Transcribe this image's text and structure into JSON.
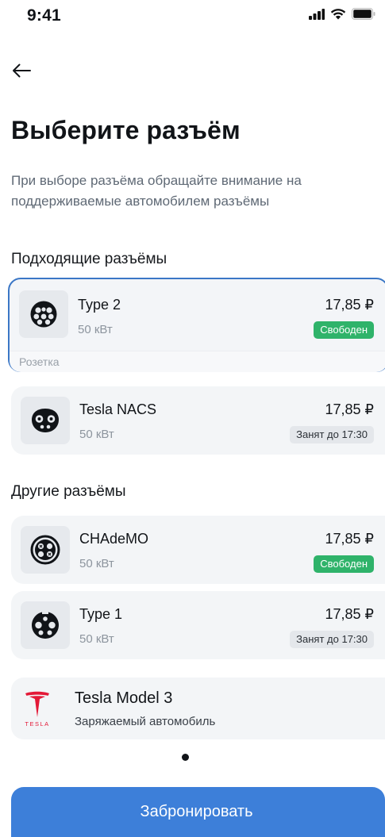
{
  "status_bar": {
    "time": "9:41",
    "icons": [
      "signal-icon",
      "wifi-icon",
      "battery-icon"
    ]
  },
  "nav": {
    "back_icon": "arrow-left-icon"
  },
  "header": {
    "title": "Выберите разъём",
    "subtitle": "При выборе разъёма обращайте внимание на поддерживаемые автомобилем разъёмы"
  },
  "suitable": {
    "title": "Подходящие разъёмы",
    "connectors": [
      {
        "name": "Type 2",
        "power": "50 кВт",
        "price": "17,85 ₽",
        "status": "Свободен",
        "status_type": "free",
        "icon": "type2-connector-icon",
        "footer": "Розетка"
      },
      {
        "name": "Tesla NACS",
        "power": "50 кВт",
        "price": "17,85 ₽",
        "status": "Занят до 17:30",
        "status_type": "busy",
        "icon": "tesla-nacs-connector-icon"
      }
    ]
  },
  "other": {
    "title": "Другие разъёмы",
    "connectors": [
      {
        "name": "CHAdeMO",
        "power": "50 кВт",
        "price": "17,85 ₽",
        "status": "Свободен",
        "status_type": "free",
        "icon": "chademo-connector-icon"
      },
      {
        "name": "Type 1",
        "power": "50 кВт",
        "price": "17,85 ₽",
        "status": "Занят до 17:30",
        "status_type": "busy",
        "icon": "type1-connector-icon"
      }
    ]
  },
  "car": {
    "name": "Tesla Model 3",
    "subtitle": "Заряжаемый автомобиль",
    "logo": "tesla-logo-icon",
    "logo_text": "TESLA"
  },
  "pagination": {
    "pages": 1,
    "active": 1
  },
  "cta": {
    "label": "Забронировать"
  },
  "colors": {
    "accent": "#3d7fd9",
    "selected_border": "#3b77c6",
    "free": "#2fb36a",
    "busy_bg": "#e4e7eb",
    "card_bg": "#f3f5f7",
    "tesla_red": "#e31937"
  }
}
